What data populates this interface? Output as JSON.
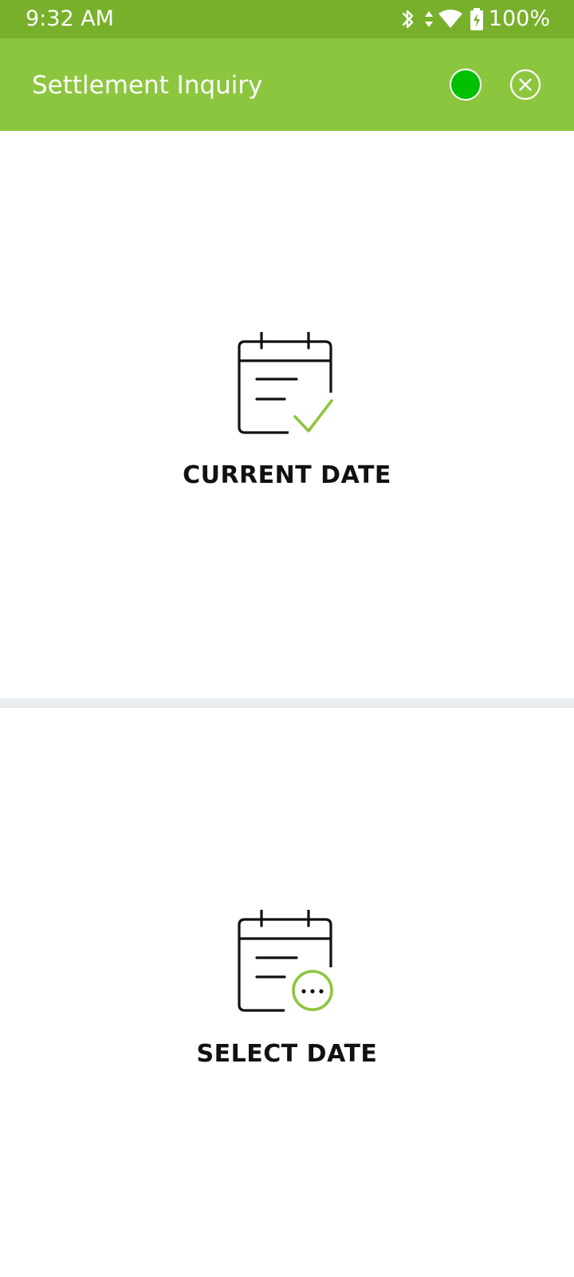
{
  "status_bar": {
    "time": "9:32 AM",
    "battery": "100%",
    "icons": [
      "bluetooth-icon",
      "data-arrows-icon",
      "wifi-icon",
      "battery-charging-icon"
    ]
  },
  "app_bar": {
    "title": "Settlement Inquiry",
    "status_indicator_color": "#00c000",
    "close_icon": "close-circle-icon"
  },
  "options": {
    "current_date": {
      "label": "CURRENT DATE",
      "icon": "calendar-check-icon"
    },
    "select_date": {
      "label": "SELECT DATE",
      "icon": "calendar-more-icon"
    }
  },
  "colors": {
    "status_bar": "#78b02c",
    "app_bar": "#8cc63f",
    "accent": "#8cc63f",
    "divider": "#e9edf0"
  }
}
